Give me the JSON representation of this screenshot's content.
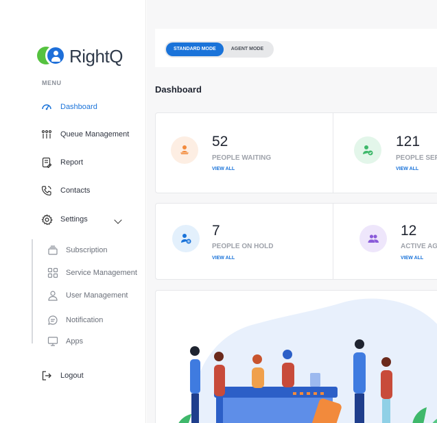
{
  "brand": {
    "name": "RightQ"
  },
  "sidebar": {
    "menu_title": "MENU",
    "items": [
      {
        "label": "Dashboard",
        "icon": "gauge-icon",
        "active": true
      },
      {
        "label": "Queue Management",
        "icon": "queue-people-icon"
      },
      {
        "label": "Report",
        "icon": "report-icon"
      },
      {
        "label": "Contacts",
        "icon": "phone-icon"
      },
      {
        "label": "Settings",
        "icon": "gear-icon",
        "expanded": true
      }
    ],
    "settings_sub": [
      {
        "label": "Subscription",
        "icon": "subscription-icon"
      },
      {
        "label": "Service Management",
        "icon": "grid-icon"
      },
      {
        "label": "User Management",
        "icon": "user-icon"
      },
      {
        "label": "Notification",
        "icon": "chat-bubble-icon"
      },
      {
        "label": "Apps",
        "icon": "monitor-icon"
      }
    ],
    "logout": {
      "label": "Logout",
      "icon": "logout-icon"
    }
  },
  "mode_toggle": {
    "standard": "STANDARD MODE",
    "agent": "AGENT MODE",
    "selected": "standard"
  },
  "page": {
    "title": "Dashboard"
  },
  "stats": [
    {
      "value": "52",
      "label": "PEOPLE WAITING",
      "link": "VIEW ALL",
      "icon": "person-waiting-icon",
      "color": "#f28a3c",
      "bg": "#fdeee3"
    },
    {
      "value": "121",
      "label": "PEOPLE SER",
      "link": "VIEW ALL",
      "icon": "person-served-icon",
      "color": "#3fb86b",
      "bg": "#e3f6ea"
    },
    {
      "value": "7",
      "label": "PEOPLE ON HOLD",
      "link": "VIEW ALL",
      "icon": "person-hold-icon",
      "color": "#1a73d9",
      "bg": "#e3f0fc"
    },
    {
      "value": "12",
      "label": "ACTIVE AGE",
      "link": "VIEW ALL",
      "icon": "agents-icon",
      "color": "#8a5bd9",
      "bg": "#eee6fb"
    }
  ],
  "colors": {
    "accent": "#1a73d9",
    "brand_green": "#55c23f",
    "brand_blue": "#1e6fd9"
  }
}
